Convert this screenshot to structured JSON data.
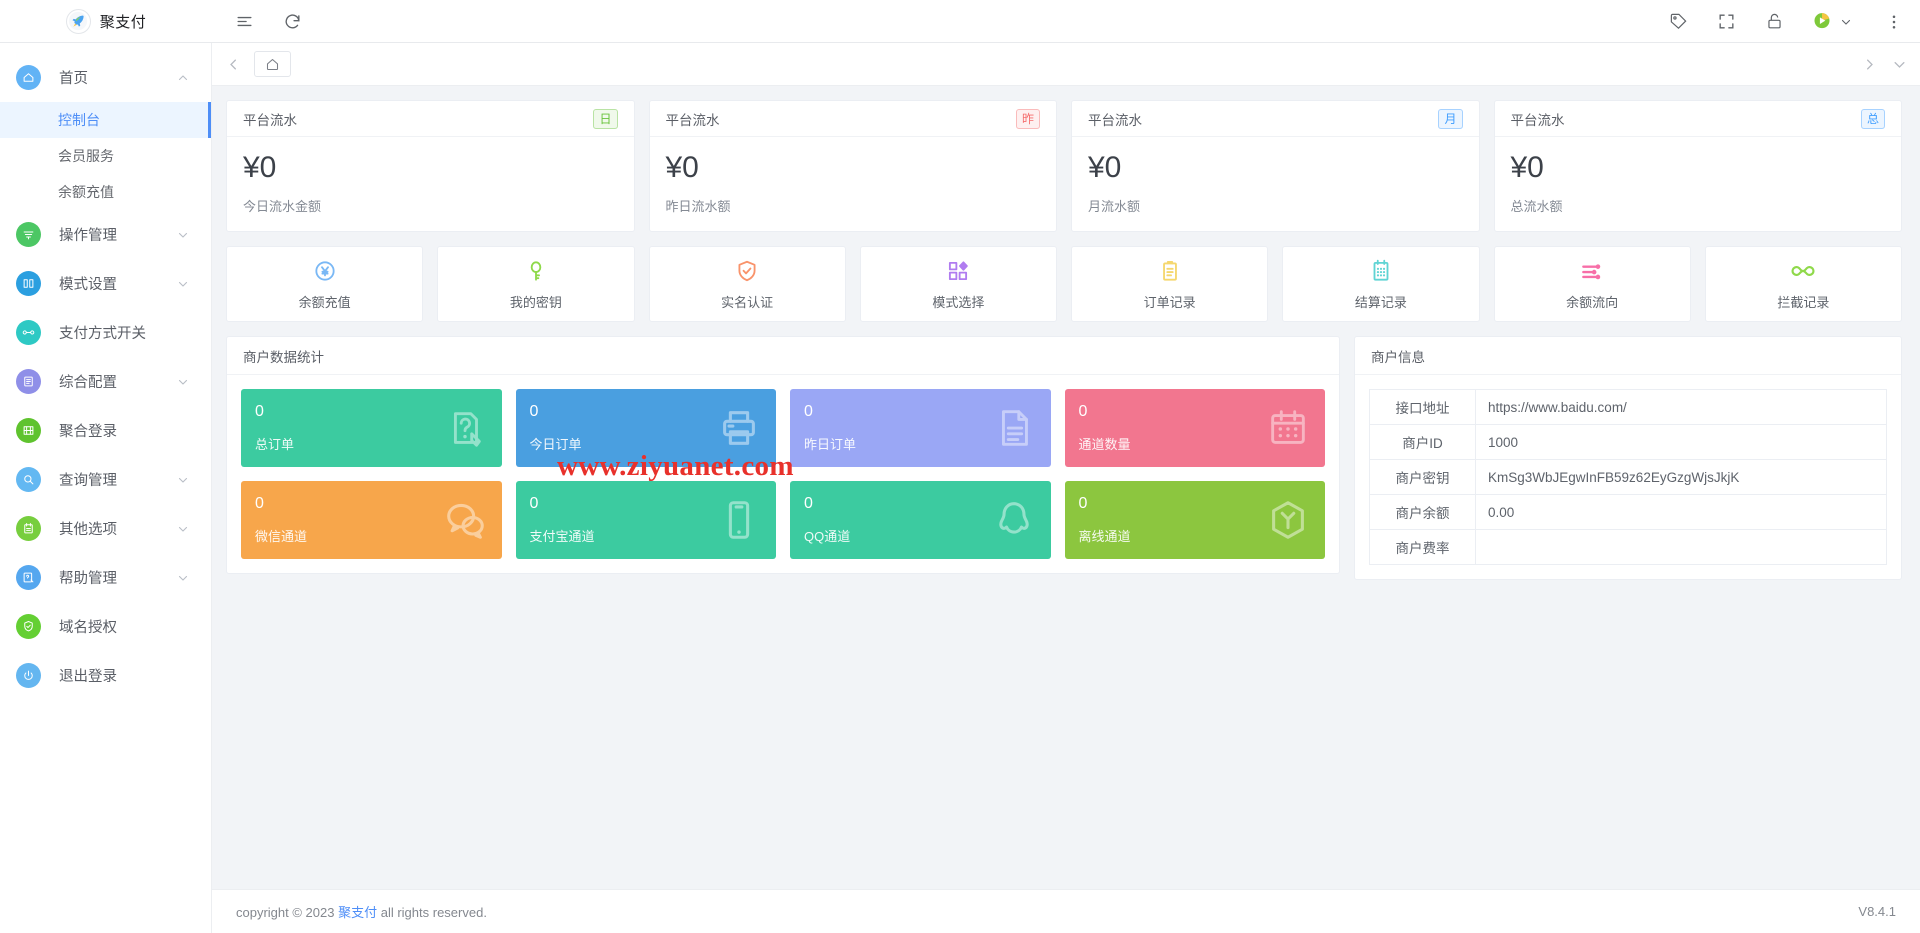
{
  "browser": {
    "brand_name": "聚支付",
    "icons_left": [
      "menu-icon",
      "reload-icon"
    ],
    "icons_right": [
      "tag-icon",
      "fullscreen-icon",
      "lock-icon",
      "profile-avatar",
      "chevron-down-icon",
      "more-vertical-icon"
    ]
  },
  "sidebar": {
    "groups": [
      {
        "label": "首页",
        "icon": "home-icon",
        "color": "#62b3f5",
        "expanded": true,
        "caret": "chevron-up-icon",
        "children": [
          {
            "label": "控制台",
            "active": true
          },
          {
            "label": "会员服务",
            "active": false
          },
          {
            "label": "余额充值",
            "active": false
          }
        ]
      },
      {
        "label": "操作管理",
        "icon": "operations-icon",
        "color": "#4cc764",
        "expanded": false,
        "caret": "chevron-down-icon",
        "children": []
      },
      {
        "label": "模式设置",
        "icon": "mode-icon",
        "color": "#2b9fe0",
        "expanded": false,
        "caret": "chevron-down-icon",
        "children": []
      },
      {
        "label": "支付方式开关",
        "icon": "payment-switch-icon",
        "color": "#2ec9c4",
        "expanded": false,
        "caret": "",
        "children": []
      },
      {
        "label": "综合配置",
        "icon": "config-icon",
        "color": "#8f8fe8",
        "expanded": false,
        "caret": "chevron-down-icon",
        "children": []
      },
      {
        "label": "聚合登录",
        "icon": "aggregate-login-icon",
        "color": "#5fc32e",
        "expanded": false,
        "caret": "",
        "children": []
      },
      {
        "label": "查询管理",
        "icon": "search-icon",
        "color": "#63b8f2",
        "expanded": false,
        "caret": "chevron-down-icon",
        "children": []
      },
      {
        "label": "其他选项",
        "icon": "other-options-icon",
        "color": "#77ce3e",
        "expanded": false,
        "caret": "chevron-down-icon",
        "children": []
      },
      {
        "label": "帮助管理",
        "icon": "help-icon",
        "color": "#55a7ef",
        "expanded": false,
        "caret": "chevron-down-icon",
        "children": []
      },
      {
        "label": "域名授权",
        "icon": "shield-check-icon",
        "color": "#64cf33",
        "expanded": false,
        "caret": "",
        "children": []
      },
      {
        "label": "退出登录",
        "icon": "power-icon",
        "color": "#64b6f0",
        "expanded": false,
        "caret": "",
        "children": []
      }
    ]
  },
  "tabbar": {
    "prev_icon": "chevron-left-icon",
    "next_icon": "chevron-right-icon",
    "dropdown_icon": "chevron-down-icon",
    "home_tab_icon": "home-outline-icon"
  },
  "stat_cards": [
    {
      "title": "平台流水",
      "badge": "日",
      "badge_color": "#67c23a",
      "badge_bg": "#f0f9eb",
      "value": "¥0",
      "caption": "今日流水金额"
    },
    {
      "title": "平台流水",
      "badge": "昨",
      "badge_color": "#f56c6c",
      "badge_bg": "#fef0f0",
      "value": "¥0",
      "caption": "昨日流水额"
    },
    {
      "title": "平台流水",
      "badge": "月",
      "badge_color": "#409eff",
      "badge_bg": "#ecf5ff",
      "value": "¥0",
      "caption": "月流水额"
    },
    {
      "title": "平台流水",
      "badge": "总",
      "badge_color": "#409eff",
      "badge_bg": "#ecf5ff",
      "value": "¥0",
      "caption": "总流水额"
    }
  ],
  "quick_actions": [
    {
      "label": "余额充值",
      "icon": "yen-circle-icon",
      "color": "#7ab8f5"
    },
    {
      "label": "我的密钥",
      "icon": "key-icon",
      "color": "#8fd94a"
    },
    {
      "label": "实名认证",
      "icon": "shield-check-icon",
      "color": "#f9936b"
    },
    {
      "label": "模式选择",
      "icon": "squares-icon",
      "color": "#b07cf0"
    },
    {
      "label": "订单记录",
      "icon": "clipboard-icon",
      "color": "#f5d76e"
    },
    {
      "label": "结算记录",
      "icon": "calendar-grid-icon",
      "color": "#5fd4d4"
    },
    {
      "label": "余额流向",
      "icon": "sliders-icon",
      "color": "#f76fa8"
    },
    {
      "label": "拦截记录",
      "icon": "infinity-icon",
      "color": "#8fd94a"
    }
  ],
  "stats_panel": {
    "title": "商户数据统计",
    "tiles": [
      {
        "num": "0",
        "caption": "总订单",
        "bg": "#3ccba0",
        "icon": "note-question-icon"
      },
      {
        "num": "0",
        "caption": "今日订单",
        "bg": "#4a9fe0",
        "icon": "printer-icon"
      },
      {
        "num": "0",
        "caption": "昨日订单",
        "bg": "#9aa7f5",
        "icon": "document-list-icon"
      },
      {
        "num": "0",
        "caption": "通道数量",
        "bg": "#f2768f",
        "icon": "calendar-icon"
      },
      {
        "num": "0",
        "caption": "微信通道",
        "bg": "#f7a64b",
        "icon": "wechat-icon"
      },
      {
        "num": "0",
        "caption": "支付宝通道",
        "bg": "#3ccba0",
        "icon": "mobile-icon"
      },
      {
        "num": "0",
        "caption": "QQ通道",
        "bg": "#3ccba0",
        "icon": "qq-penguin-icon"
      },
      {
        "num": "0",
        "caption": "离线通道",
        "bg": "#8cc63f",
        "icon": "box-icon"
      }
    ]
  },
  "info_panel": {
    "title": "商户信息",
    "rows": [
      {
        "key": "接口地址",
        "value": "https://www.baidu.com/"
      },
      {
        "key": "商户ID",
        "value": "1000"
      },
      {
        "key": "商户密钥",
        "value": "KmSg3WbJEgwInFB59z62EyGzgWjsJkjK"
      },
      {
        "key": "商户余额",
        "value": "0.00"
      },
      {
        "key": "商户费率",
        "value": ""
      }
    ]
  },
  "footer": {
    "prefix": "copyright © 2023 ",
    "link": "聚支付",
    "suffix": " all rights reserved.",
    "version": "V8.4.1"
  },
  "watermark": {
    "text": "www.ziyuanet.com",
    "color": "#e8312b"
  }
}
